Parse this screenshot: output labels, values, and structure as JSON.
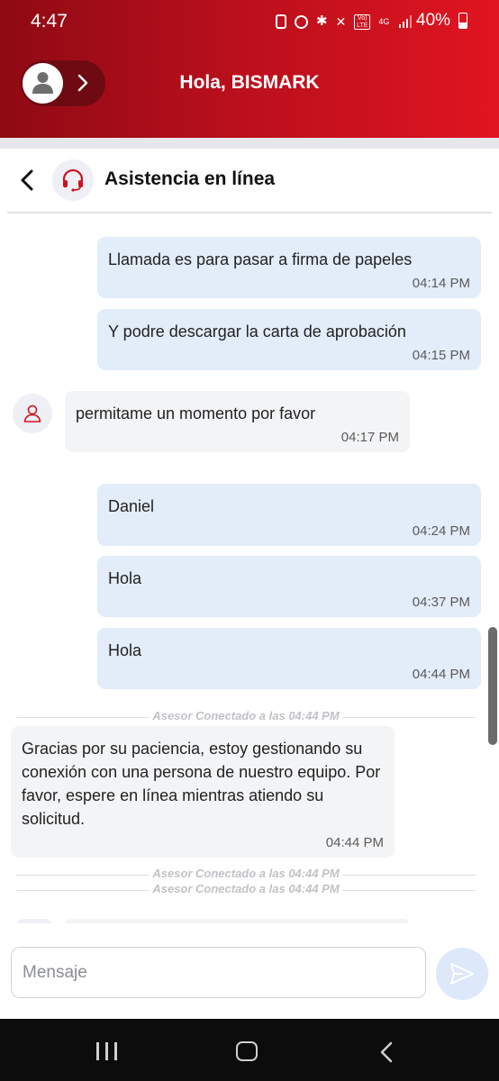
{
  "status_bar": {
    "time": "4:47",
    "battery": "40%",
    "network": "4G",
    "volte": "Vo) LTE",
    "icons": [
      "sim-icon",
      "alarm-icon",
      "bluetooth-icon",
      "mute-icon",
      "volte-icon",
      "network-4g-icon",
      "signal-icon",
      "battery-icon"
    ]
  },
  "header": {
    "greeting": "Hola, BISMARK",
    "avatar_icon": "user-icon",
    "expand_icon": "chevron-right-icon",
    "gradient_start": "#8e0a14",
    "gradient_end": "#e01521"
  },
  "chat": {
    "title": "Asistencia en línea",
    "back_icon": "chevron-left-icon",
    "agent_icon": "headset-icon",
    "messages": [
      {
        "side": "out",
        "text": "Llamada es para pasar a firma de papeles",
        "time": "04:14 PM"
      },
      {
        "side": "out",
        "text": "Y podre descargar la carta de  aprobación",
        "time": "04:15 PM"
      },
      {
        "side": "in",
        "text": "permitame un momento por favor",
        "time": "04:17 PM",
        "avatar": true
      },
      {
        "side": "out",
        "text": "Daniel",
        "time": "04:24 PM"
      },
      {
        "side": "out",
        "text": "Hola",
        "time": "04:37 PM"
      },
      {
        "side": "out",
        "text": "Hola",
        "time": "04:44 PM"
      },
      {
        "side": "system",
        "text": "Asesor Conectado a las 04:44 PM"
      },
      {
        "side": "in",
        "text": "Gracias por su paciencia, estoy gestionando su conexión con una persona de nuestro equipo. Por favor, espere en línea mientras atiendo su solicitud.",
        "time": "04:44 PM"
      },
      {
        "side": "system",
        "text": "Asesor Conectado a las 04:44 PM"
      },
      {
        "side": "system",
        "text": "Asesor Conectado a las 04:44 PM"
      }
    ]
  },
  "composer": {
    "placeholder": "Mensaje",
    "value": "",
    "send_icon": "send-icon"
  },
  "navbar": {
    "icons": [
      "recents-icon",
      "home-icon",
      "back-icon"
    ]
  },
  "colors": {
    "brand_red": "#d0121e",
    "outgoing_bubble": "#e3ecf9",
    "incoming_bubble": "#f3f4f6"
  }
}
